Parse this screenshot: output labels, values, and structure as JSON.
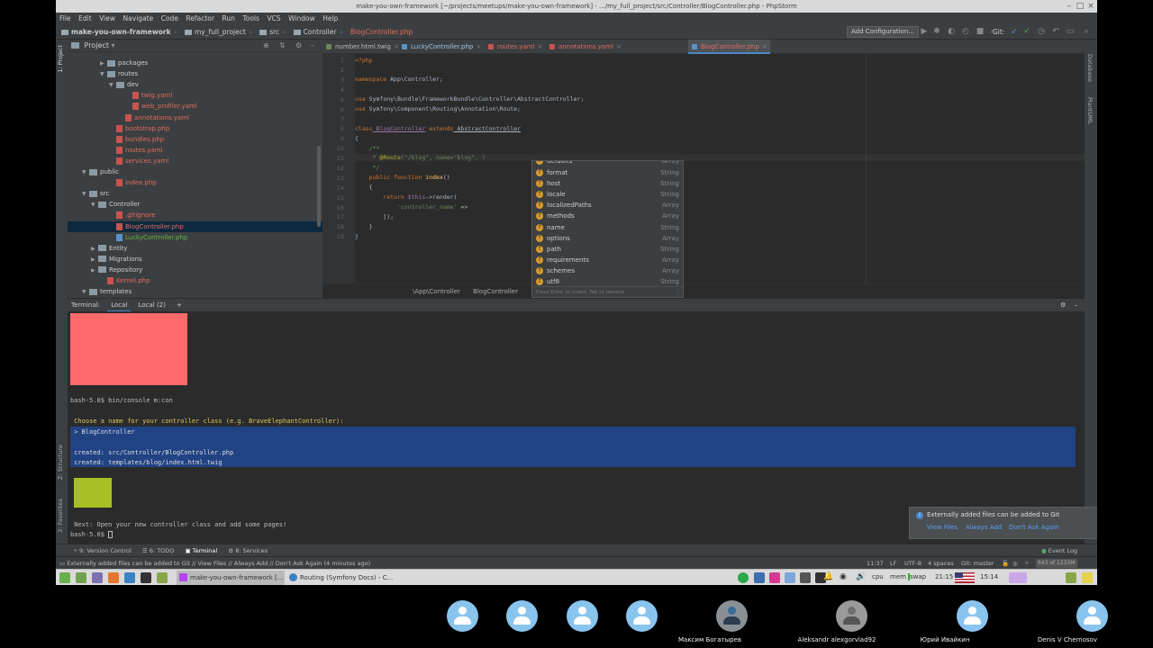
{
  "window": {
    "title": "make-you-own-framework [~/projects/meetups/make-you-own-framework] - .../my_full_project/src/Controller/BlogController.php - PhpStorm"
  },
  "menu": [
    "File",
    "Edit",
    "View",
    "Navigate",
    "Code",
    "Refactor",
    "Run",
    "Tools",
    "VCS",
    "Window",
    "Help"
  ],
  "navbar": {
    "crumbs": [
      "make-you-own-framework",
      "my_full_project",
      "src",
      "Controller",
      "BlogController.php"
    ],
    "add_config": "Add Configuration...",
    "git_label": "Git:"
  },
  "project": {
    "header": "Project",
    "rows": [
      {
        "label": "packages",
        "kind": "folder",
        "arrow": "▶"
      },
      {
        "label": "routes",
        "kind": "folder",
        "arrow": "▼"
      },
      {
        "label": "dev",
        "kind": "folder",
        "arrow": "▼"
      },
      {
        "label": "twig.yaml",
        "kind": "file-red",
        "arrow": ""
      },
      {
        "label": "web_profiler.yaml",
        "kind": "file-red",
        "arrow": ""
      },
      {
        "label": "annotations.yaml",
        "kind": "file-red",
        "arrow": ""
      },
      {
        "label": "bootstrap.php",
        "kind": "file-red",
        "arrow": ""
      },
      {
        "label": "bundles.php",
        "kind": "file-red",
        "arrow": ""
      },
      {
        "label": "routes.yaml",
        "kind": "file-red",
        "arrow": ""
      },
      {
        "label": "services.yaml",
        "kind": "file-red",
        "arrow": ""
      },
      {
        "label": "public",
        "kind": "folder",
        "arrow": "▼"
      },
      {
        "label": "index.php",
        "kind": "file-red",
        "arrow": ""
      },
      {
        "label": "src",
        "kind": "folder",
        "arrow": "▼"
      },
      {
        "label": "Controller",
        "kind": "folder",
        "arrow": "▼"
      },
      {
        "label": ".gitignore",
        "kind": "file-red",
        "arrow": ""
      },
      {
        "label": "BlogController.php",
        "kind": "file-sel",
        "arrow": ""
      },
      {
        "label": "LuckyController.php",
        "kind": "file-green",
        "arrow": ""
      },
      {
        "label": "Entity",
        "kind": "folder",
        "arrow": "▶"
      },
      {
        "label": "Migrations",
        "kind": "folder",
        "arrow": "▶"
      },
      {
        "label": "Repository",
        "kind": "folder",
        "arrow": "▶"
      },
      {
        "label": "Kernel.php",
        "kind": "file-red",
        "arrow": ""
      },
      {
        "label": "templates",
        "kind": "folder",
        "arrow": "▼"
      }
    ]
  },
  "tabs": [
    "number.html.twig",
    "LuckyController.php",
    "routes.yaml",
    "annotations.yaml",
    "BlogController.php"
  ],
  "editor": {
    "lines": [
      "1",
      "2",
      "3",
      "4",
      "5",
      "6",
      "7",
      "8",
      "9",
      "10",
      "11",
      "12",
      "13",
      "14",
      "15",
      "16",
      "17",
      "18",
      "19"
    ],
    "code": {
      "l1": "<?php",
      "l3_kw": "namespace",
      "l3": " App\\Controller;",
      "l5_kw": "use",
      "l5": " Symfony\\Bundle\\FrameworkBundle\\Controller\\AbstractController;",
      "l6_kw": "use",
      "l6": " Symfony\\Component\\Routing\\Annotation\\Route;",
      "l8_kw": "class",
      "l8_cls": " BlogController",
      "l8_kw2": " extends",
      "l8_rest": " AbstractController",
      "l9": "{",
      "l10": "    /**",
      "l11_a": "     * ",
      "l11_ann": "@Route",
      "l11_str": "(\"/blog\", name=\"blog\", )",
      "l12": "     */",
      "l13_kw": "    public function",
      "l13_fn": " index",
      "l13_rest": "()",
      "l14": "    {",
      "l15_kw": "        return",
      "l15_var": " $this",
      "l15_rest": "->render(",
      "l16_str": "            'controller_name'",
      "l16_rest": " =>",
      "l17": "        ]);",
      "l18": "    }",
      "l19": "}"
    },
    "breadcrumb": [
      "\\App\\Controller",
      "BlogController"
    ]
  },
  "completion": {
    "items": [
      {
        "name": "format",
        "type": "String"
      },
      {
        "name": "host",
        "type": "String"
      },
      {
        "name": "locale",
        "type": "String"
      },
      {
        "name": "localizedPaths",
        "type": "Array"
      },
      {
        "name": "methods",
        "type": "Array"
      },
      {
        "name": "name",
        "type": "String"
      },
      {
        "name": "options",
        "type": "Array"
      },
      {
        "name": "path",
        "type": "String"
      },
      {
        "name": "requirements",
        "type": "Array"
      },
      {
        "name": "schemes",
        "type": "Array"
      },
      {
        "name": "utf8",
        "type": "String"
      }
    ],
    "top_cut": "defaults",
    "top_cut_type": "Array",
    "footer": "Press Enter to insert, Tab to replace"
  },
  "terminal": {
    "label": "Terminal:",
    "tabs": [
      "Local",
      "Local (2)"
    ],
    "prompt1": "bash-5.0$ bin/console m:con",
    "question": " Choose a name for your controller class (e.g. BraveElephantController):",
    "answer": " > BlogController",
    "created1": " created: src/Controller/BlogController.php",
    "created2": " created: templates/blog/index.html.twig",
    "next": " Next: Open your new controller class and add some pages!",
    "prompt2": "bash-5.0$"
  },
  "notification": {
    "text": "Externally added files can be added to Git",
    "links": [
      "View Files",
      "Always Add",
      "Don't Ask Again"
    ]
  },
  "bottom_tabs": [
    "9: Version Control",
    "6: TODO",
    "Terminal",
    "8: Services"
  ],
  "event_log": "Event Log",
  "status": {
    "message": "Externally added files can be added to Git // View Files // Always Add // Don't Ask Again (4 minutes ago)",
    "position": "11:37",
    "line_sep": "LF",
    "encoding": "UTF-8",
    "indent": "4 spaces",
    "git": "Git: master",
    "memory": "643 of 1233M"
  },
  "taskbar": {
    "tasks": [
      "make-you-own-framework [...",
      "Routing (Symfony Docs) - C..."
    ],
    "cpu": "cpu",
    "mem": "mem",
    "swap": "swap",
    "time1": "21:15",
    "time2": "15:14"
  },
  "participants": [
    "",
    "",
    "",
    "",
    "Максим Богатырев",
    "Aleksandr alexgorvlad92",
    "Юрий Ивайкин",
    "Denis V Chernosov"
  ],
  "colors": {
    "selection": "#214283",
    "terminal_red": "#ff6b6b",
    "terminal_green": "#a8c023",
    "accent": "#4a88c7"
  }
}
